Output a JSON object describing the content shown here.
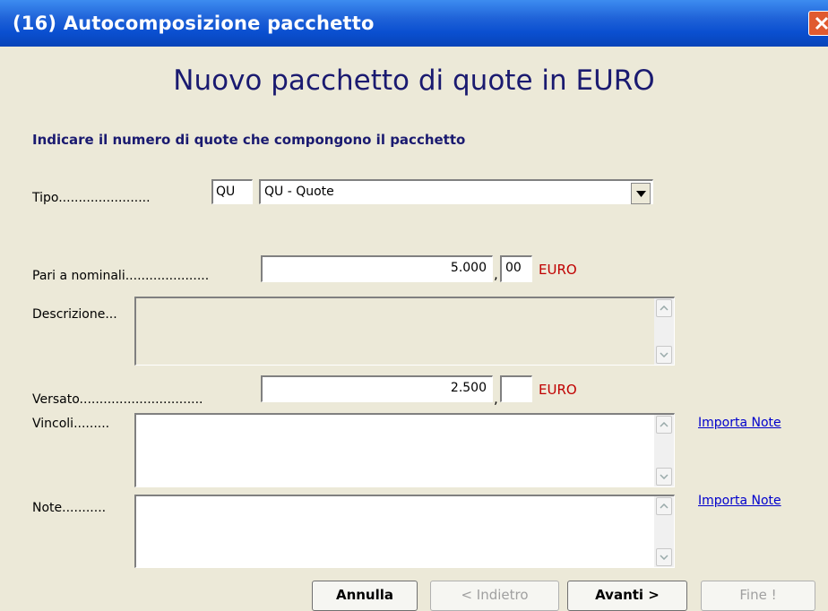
{
  "window": {
    "title": "(16) Autocomposizione pacchetto"
  },
  "heading": "Nuovo pacchetto di quote in EURO",
  "instruction": "Indicare il numero di quote che compongono il pacchetto",
  "tipo": {
    "label": "Tipo.......................",
    "code": "QU",
    "selected": "QU - Quote"
  },
  "pari": {
    "label": "Pari a nominali.....................",
    "integer": "5.000",
    "decimal": "00",
    "currency": "EURO"
  },
  "descrizione": {
    "label": "Descrizione..."
  },
  "versato": {
    "label": "Versato...............................",
    "integer": "2.500",
    "decimal": "",
    "currency": "EURO"
  },
  "vincoli": {
    "label": "Vincoli.........",
    "link": "Importa Note"
  },
  "note": {
    "label": "Note...........",
    "link": "Importa Note"
  },
  "comma": ",",
  "buttons": {
    "cancel": "Annulla",
    "back": "< Indietro",
    "next": "Avanti  >",
    "finish": "Fine !"
  },
  "colors": {
    "title_bar": "#0a4fd0",
    "heading": "#1a1a70",
    "currency": "#c00000",
    "link": "#0000cc"
  }
}
